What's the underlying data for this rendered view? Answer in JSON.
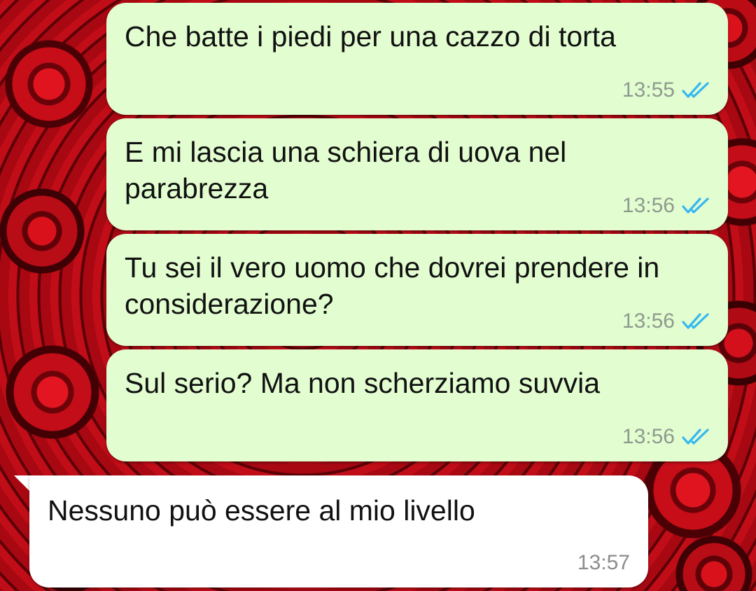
{
  "colors": {
    "outgoing_bubble": "#e2fdd0",
    "incoming_bubble": "#ffffff",
    "read_ticks": "#34b7f1",
    "background": "red roses"
  },
  "messages": [
    {
      "direction": "outgoing",
      "text": "Che batte i piedi per una cazzo di torta",
      "time": "13:55",
      "status_icon": "double-check-read-icon"
    },
    {
      "direction": "outgoing",
      "text": "E mi lascia una schiera di uova nel parabrezza",
      "time": "13:56",
      "status_icon": "double-check-read-icon"
    },
    {
      "direction": "outgoing",
      "text": "Tu sei il vero uomo che dovrei prendere in considerazione?",
      "time": "13:56",
      "status_icon": "double-check-read-icon"
    },
    {
      "direction": "outgoing",
      "text": "Sul serio? Ma non scherziamo suvvia",
      "time": "13:56",
      "status_icon": "double-check-read-icon"
    },
    {
      "direction": "incoming",
      "text": "Nessuno può essere al mio livello",
      "time": "13:57"
    }
  ]
}
